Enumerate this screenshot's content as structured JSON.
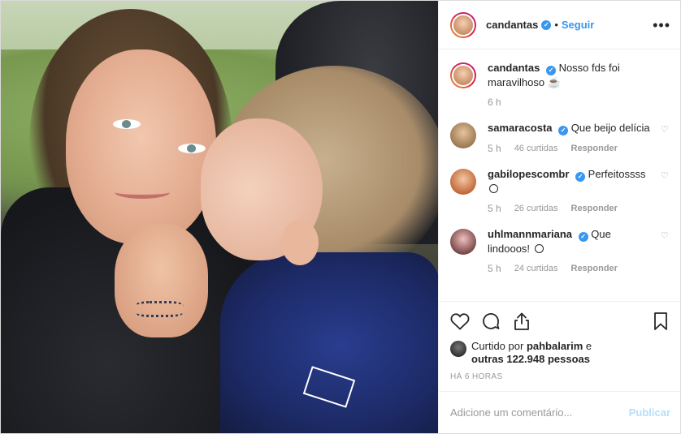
{
  "post": {
    "author": "candantas",
    "follow_label": "Seguir",
    "dot": "•",
    "caption_author": "candantas",
    "caption_text": "Nosso fds foi maravilhoso",
    "caption_time": "6 h"
  },
  "comments": [
    {
      "user": "samaracosta",
      "text": "Que beijo delícia",
      "time": "5 h",
      "likes": "46 curtidas",
      "reply": "Responder"
    },
    {
      "user": "gabilopescombr",
      "text": "Perfeitossss",
      "time": "5 h",
      "likes": "26 curtidas",
      "reply": "Responder"
    },
    {
      "user": "uhlmannmariana",
      "text": "Que lindooos!",
      "time": "5 h",
      "likes": "24 curtidas",
      "reply": "Responder"
    }
  ],
  "likes": {
    "prefix": "Curtido por",
    "user": "pahbalarim",
    "middle": "e",
    "others": "outras 122.948 pessoas"
  },
  "posted_ago": "HÁ 6 HORAS",
  "add_comment": {
    "placeholder": "Adicione um comentário...",
    "post_label": "Publicar"
  },
  "icons": {
    "verified": "verified-badge",
    "more": "more-options-icon",
    "like": "heart-icon",
    "comment": "comment-icon",
    "share": "share-icon",
    "save": "bookmark-icon"
  },
  "colors": {
    "link": "#3897f0",
    "muted": "#999999",
    "publish_disabled": "#b2dffc"
  }
}
